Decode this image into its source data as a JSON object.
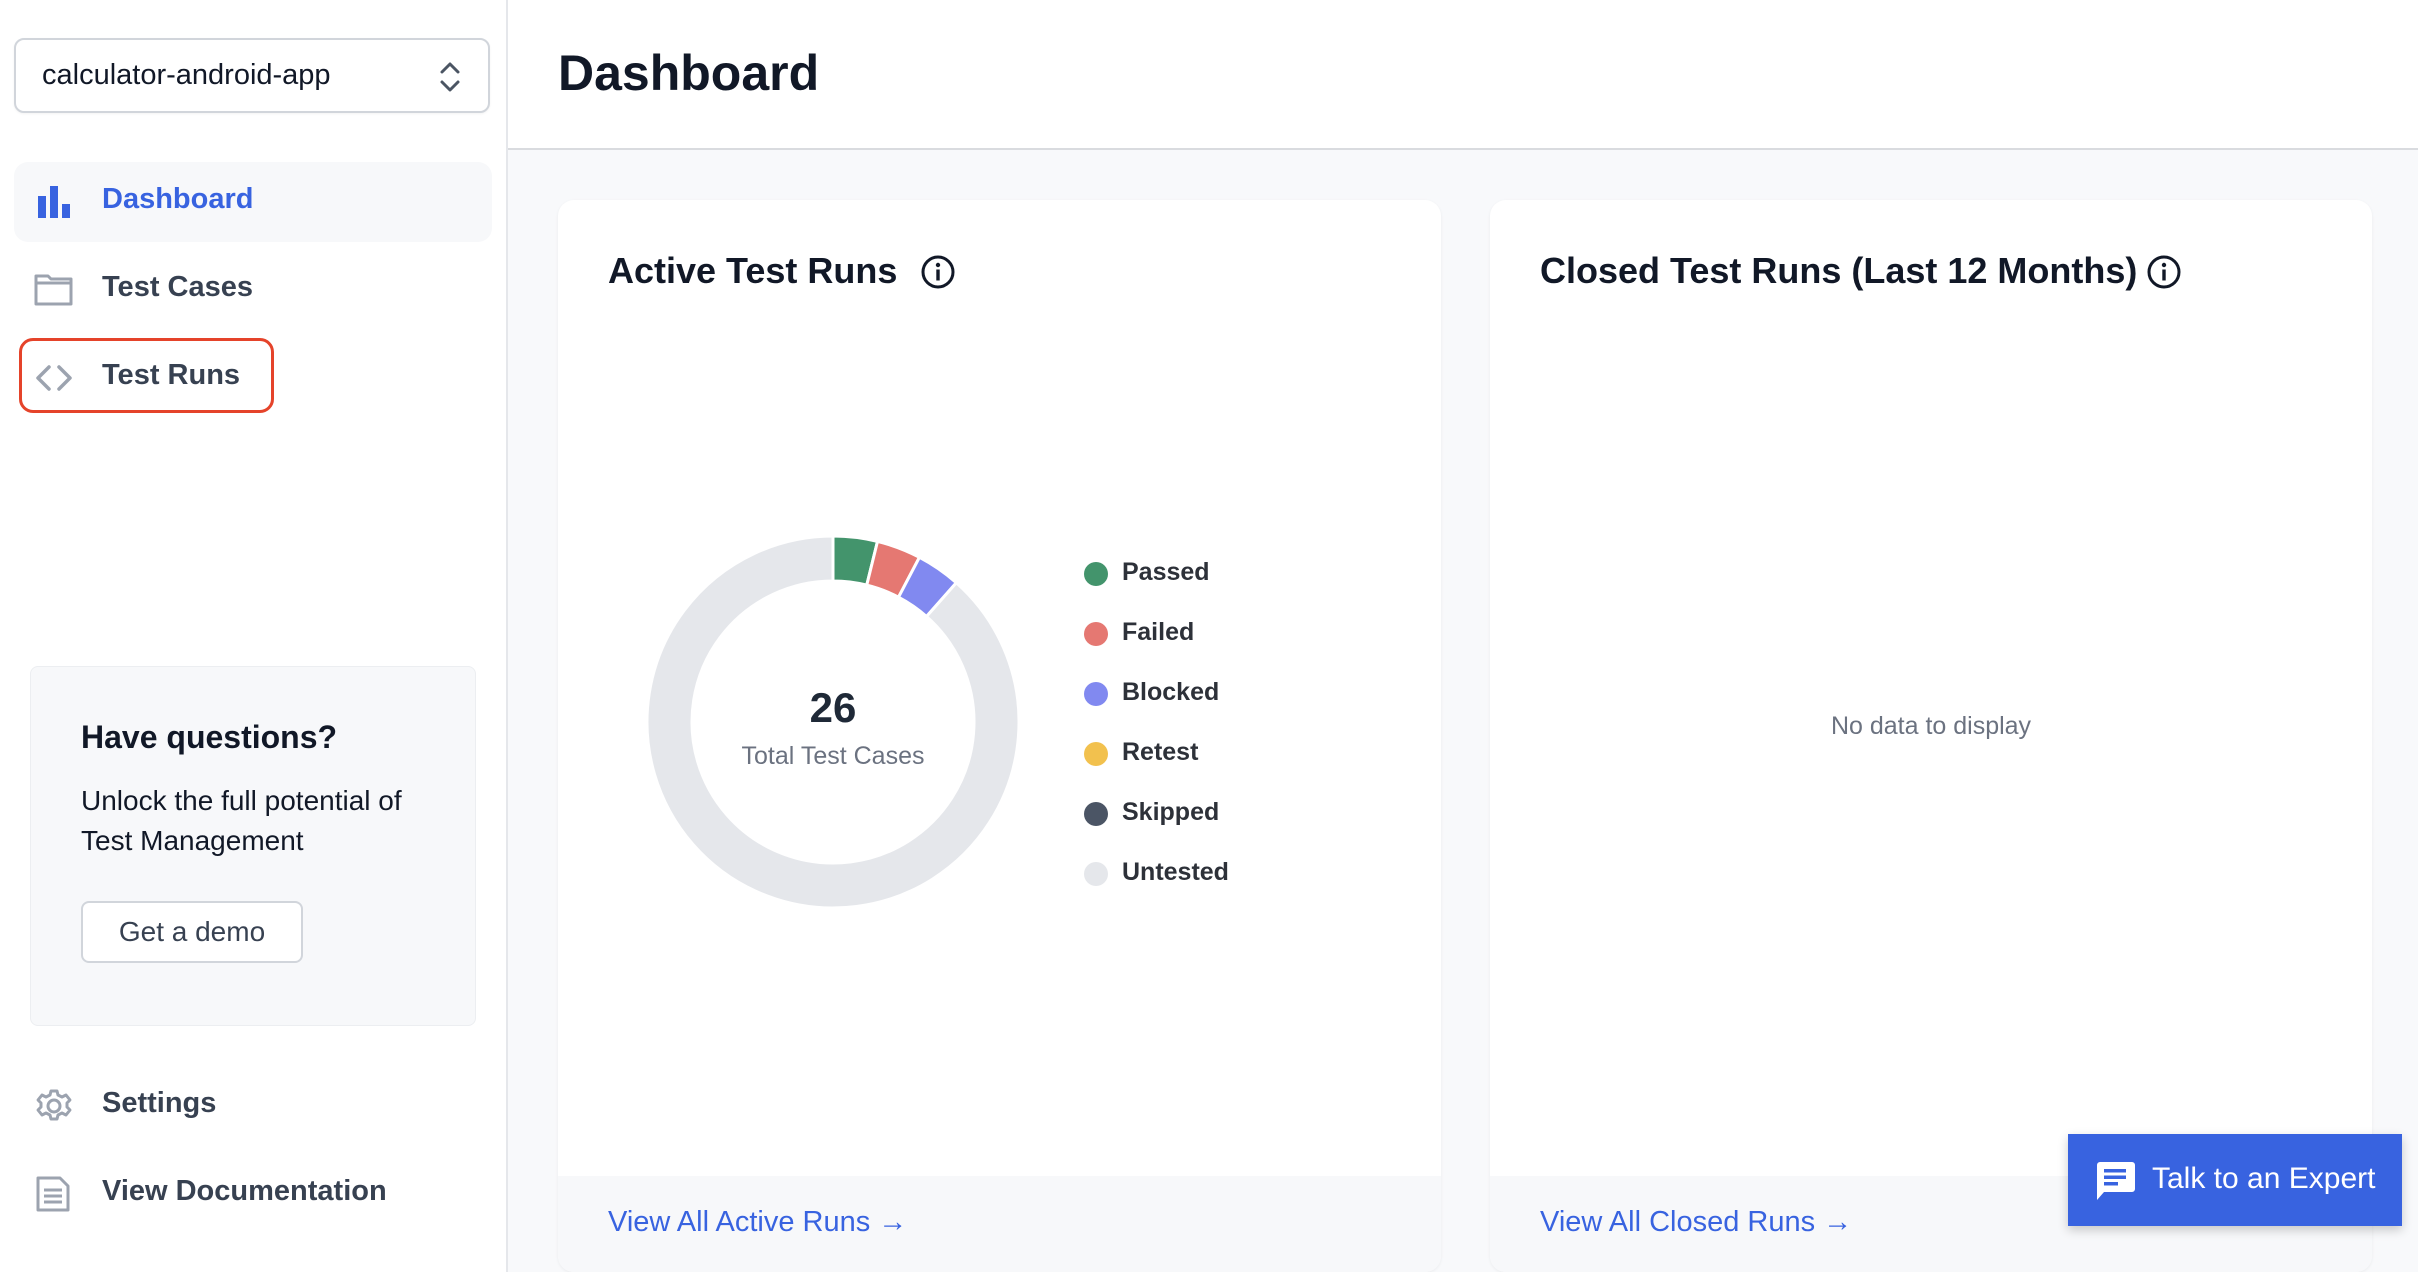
{
  "sidebar": {
    "project_select": {
      "value": "calculator-android-app",
      "icon": "chevron-up-down-icon"
    },
    "nav": [
      {
        "label": "Dashboard",
        "icon": "bar-chart-icon",
        "active": true
      },
      {
        "label": "Test Cases",
        "icon": "folder-icon",
        "active": false
      },
      {
        "label": "Test Runs",
        "icon": "code-icon",
        "active": false,
        "highlighted": true
      }
    ],
    "promo": {
      "title": "Have questions?",
      "description": "Unlock the full potential of Test Management",
      "button_label": "Get a demo"
    },
    "footer_nav": [
      {
        "label": "Settings",
        "icon": "gear-icon"
      },
      {
        "label": "View Documentation",
        "icon": "document-icon"
      }
    ]
  },
  "header": {
    "title": "Dashboard"
  },
  "cards": {
    "active": {
      "title": "Active Test Runs",
      "center_value": "26",
      "center_label": "Total Test Cases",
      "footer_link": "View All Active Runs →"
    },
    "closed": {
      "title": "Closed Test Runs (Last 12 Months)",
      "empty_text": "No data to display",
      "footer_link": "View All Closed Runs →"
    }
  },
  "chart_data": {
    "type": "pie",
    "title": "Active Test Runs",
    "donut": true,
    "total": 26,
    "categories": [
      "Passed",
      "Failed",
      "Blocked",
      "Retest",
      "Skipped",
      "Untested"
    ],
    "values": [
      1,
      1,
      1,
      0,
      0,
      23
    ],
    "colors": [
      "#43946c",
      "#e57872",
      "#8189f0",
      "#f2c14e",
      "#4b5565",
      "#e5e7eb"
    ],
    "legend_position": "right"
  },
  "expert_button": {
    "label": "Talk to an Expert",
    "icon": "chat-icon"
  },
  "colors": {
    "accent": "#3863e0",
    "highlight": "#e5432a"
  }
}
